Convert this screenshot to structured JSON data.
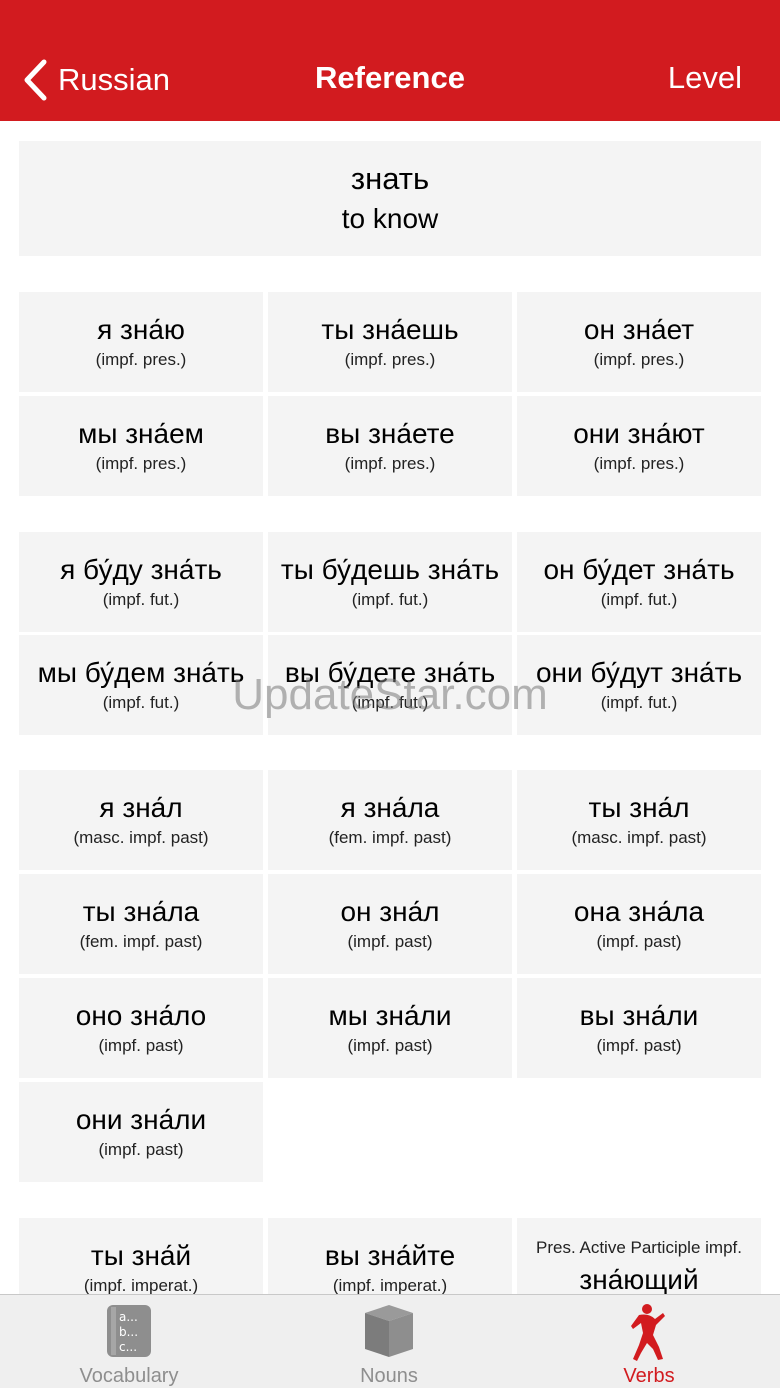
{
  "nav": {
    "back_label": "Russian",
    "title": "Reference",
    "right_label": "Level"
  },
  "header": {
    "word": "знать",
    "translation": "to know"
  },
  "present": [
    {
      "form": "я зна́ю",
      "label": "(impf. pres.)"
    },
    {
      "form": "ты зна́ешь",
      "label": "(impf. pres.)"
    },
    {
      "form": "он зна́ет",
      "label": "(impf. pres.)"
    },
    {
      "form": "мы зна́ем",
      "label": "(impf. pres.)"
    },
    {
      "form": "вы зна́ете",
      "label": "(impf. pres.)"
    },
    {
      "form": "они зна́ют",
      "label": "(impf. pres.)"
    }
  ],
  "future": [
    {
      "form": "я бу́ду зна́ть",
      "label": "(impf. fut.)"
    },
    {
      "form": "ты бу́дешь зна́ть",
      "label": "(impf. fut.)"
    },
    {
      "form": "он бу́дет зна́ть",
      "label": "(impf. fut.)"
    },
    {
      "form": "мы бу́дем зна́ть",
      "label": "(impf. fut.)"
    },
    {
      "form": "вы бу́дете зна́ть",
      "label": "(impf. fut.)"
    },
    {
      "form": "они бу́дут зна́ть",
      "label": "(impf. fut.)"
    }
  ],
  "past": [
    {
      "form": "я зна́л",
      "label": "(masc. impf. past)"
    },
    {
      "form": "я зна́ла",
      "label": "(fem. impf. past)"
    },
    {
      "form": "ты зна́л",
      "label": "(masc. impf. past)"
    },
    {
      "form": "ты зна́ла",
      "label": "(fem. impf. past)"
    },
    {
      "form": "он зна́л",
      "label": "(impf. past)"
    },
    {
      "form": "она зна́ла",
      "label": "(impf. past)"
    },
    {
      "form": "оно зна́ло",
      "label": "(impf. past)"
    },
    {
      "form": "мы зна́ли",
      "label": "(impf. past)"
    },
    {
      "form": "вы зна́ли",
      "label": "(impf. past)"
    },
    {
      "form": "они зна́ли",
      "label": "(impf. past)"
    }
  ],
  "imperative": [
    {
      "form": "ты зна́й",
      "label": "(impf. imperat.)"
    },
    {
      "form": "вы зна́йте",
      "label": "(impf. imperat.)"
    }
  ],
  "participle": {
    "label": "Pres. Active Participle impf.",
    "form": "зна́ющий"
  },
  "watermark": "UpdateStar.com",
  "tabs": [
    {
      "label": "Vocabulary",
      "icon": "vocabulary-icon"
    },
    {
      "label": "Nouns",
      "icon": "nouns-icon"
    },
    {
      "label": "Verbs",
      "icon": "verbs-icon",
      "active": true
    }
  ],
  "colors": {
    "accent": "#d21b1f",
    "cell_bg": "#f4f4f4",
    "tab_inactive": "#8e8e8e"
  }
}
